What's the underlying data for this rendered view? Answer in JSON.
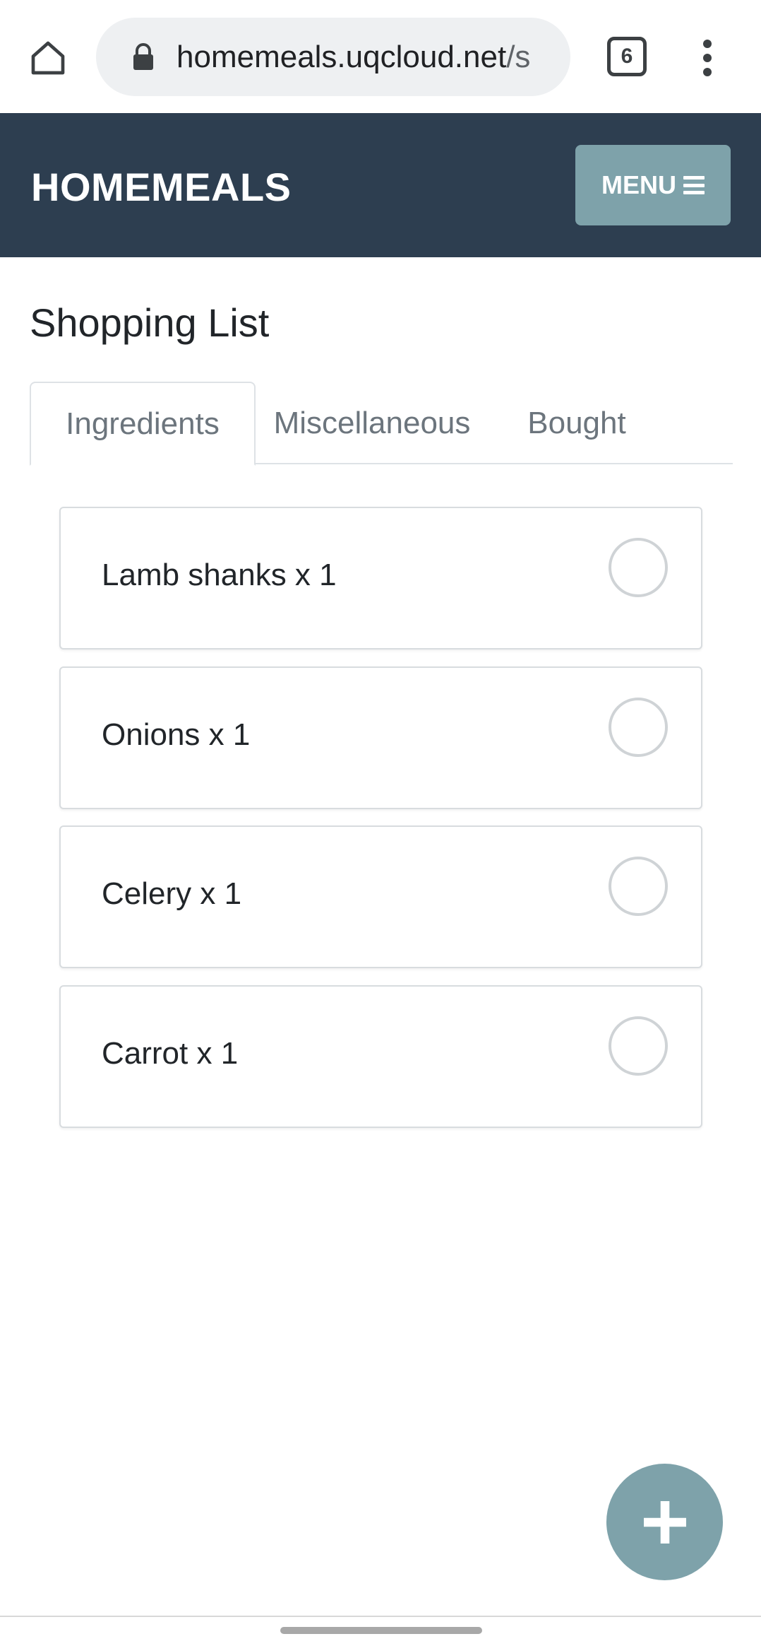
{
  "browser": {
    "url_main": "homemeals.uqcloud.net",
    "url_rest": "/s",
    "tab_count": "6"
  },
  "navbar": {
    "brand": "HOMEMEALS",
    "menu_label": "MENU"
  },
  "page": {
    "title": "Shopping List"
  },
  "tabs": [
    {
      "label": "Ingredients",
      "active": true
    },
    {
      "label": "Miscellaneous",
      "active": false
    },
    {
      "label": "Bought",
      "active": false
    }
  ],
  "items": [
    {
      "label": "Lamb shanks x 1",
      "checked": false
    },
    {
      "label": "Onions x 1",
      "checked": false
    },
    {
      "label": "Celery x 1",
      "checked": false
    },
    {
      "label": "Carrot x 1",
      "checked": false
    }
  ],
  "colors": {
    "navbar": "#2d3e50",
    "accent": "#7ea2aa"
  },
  "icons": {
    "home": "home-icon",
    "lock": "lock-icon",
    "tabs": "tab-switcher-icon",
    "more": "more-vert-icon",
    "menu": "hamburger-icon",
    "add": "plus-icon"
  }
}
